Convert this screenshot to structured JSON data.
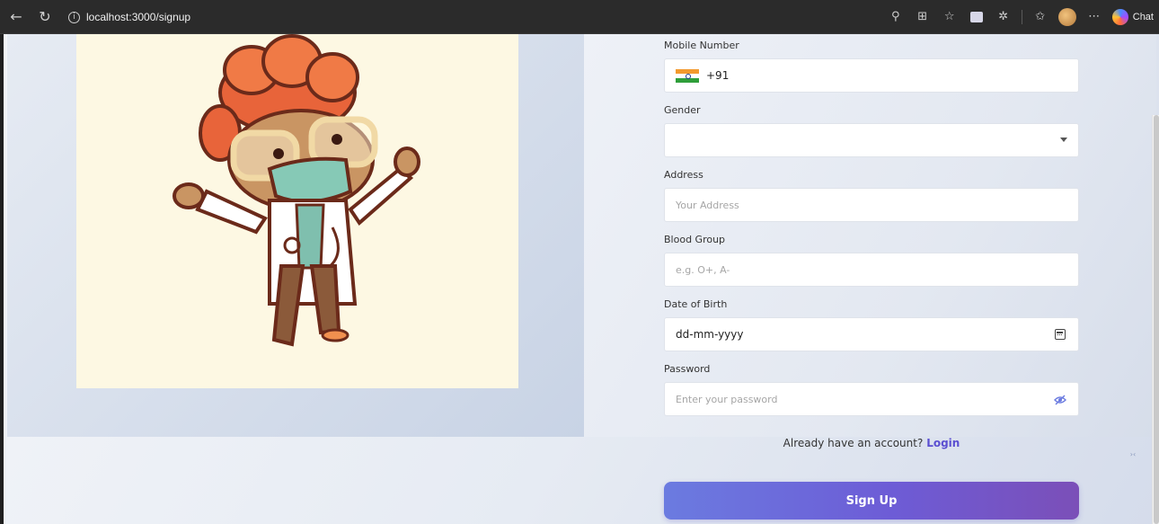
{
  "browser": {
    "url": "localhost:3000/signup",
    "chat_label": "Chat"
  },
  "form": {
    "mobile": {
      "label": "Mobile Number",
      "value": "+91"
    },
    "gender": {
      "label": "Gender",
      "value": ""
    },
    "address": {
      "label": "Address",
      "placeholder": "Your Address"
    },
    "blood_group": {
      "label": "Blood Group",
      "placeholder": "e.g. O+, A-"
    },
    "dob": {
      "label": "Date of Birth",
      "value": "dd-mm-yyyy"
    },
    "password": {
      "label": "Password",
      "placeholder": "Enter your password"
    }
  },
  "login": {
    "prompt": "Already have an account?",
    "link": "Login"
  },
  "signup_button": "Sign Up",
  "colors": {
    "accent": "#6b7be0",
    "link": "#5b4fd1"
  }
}
